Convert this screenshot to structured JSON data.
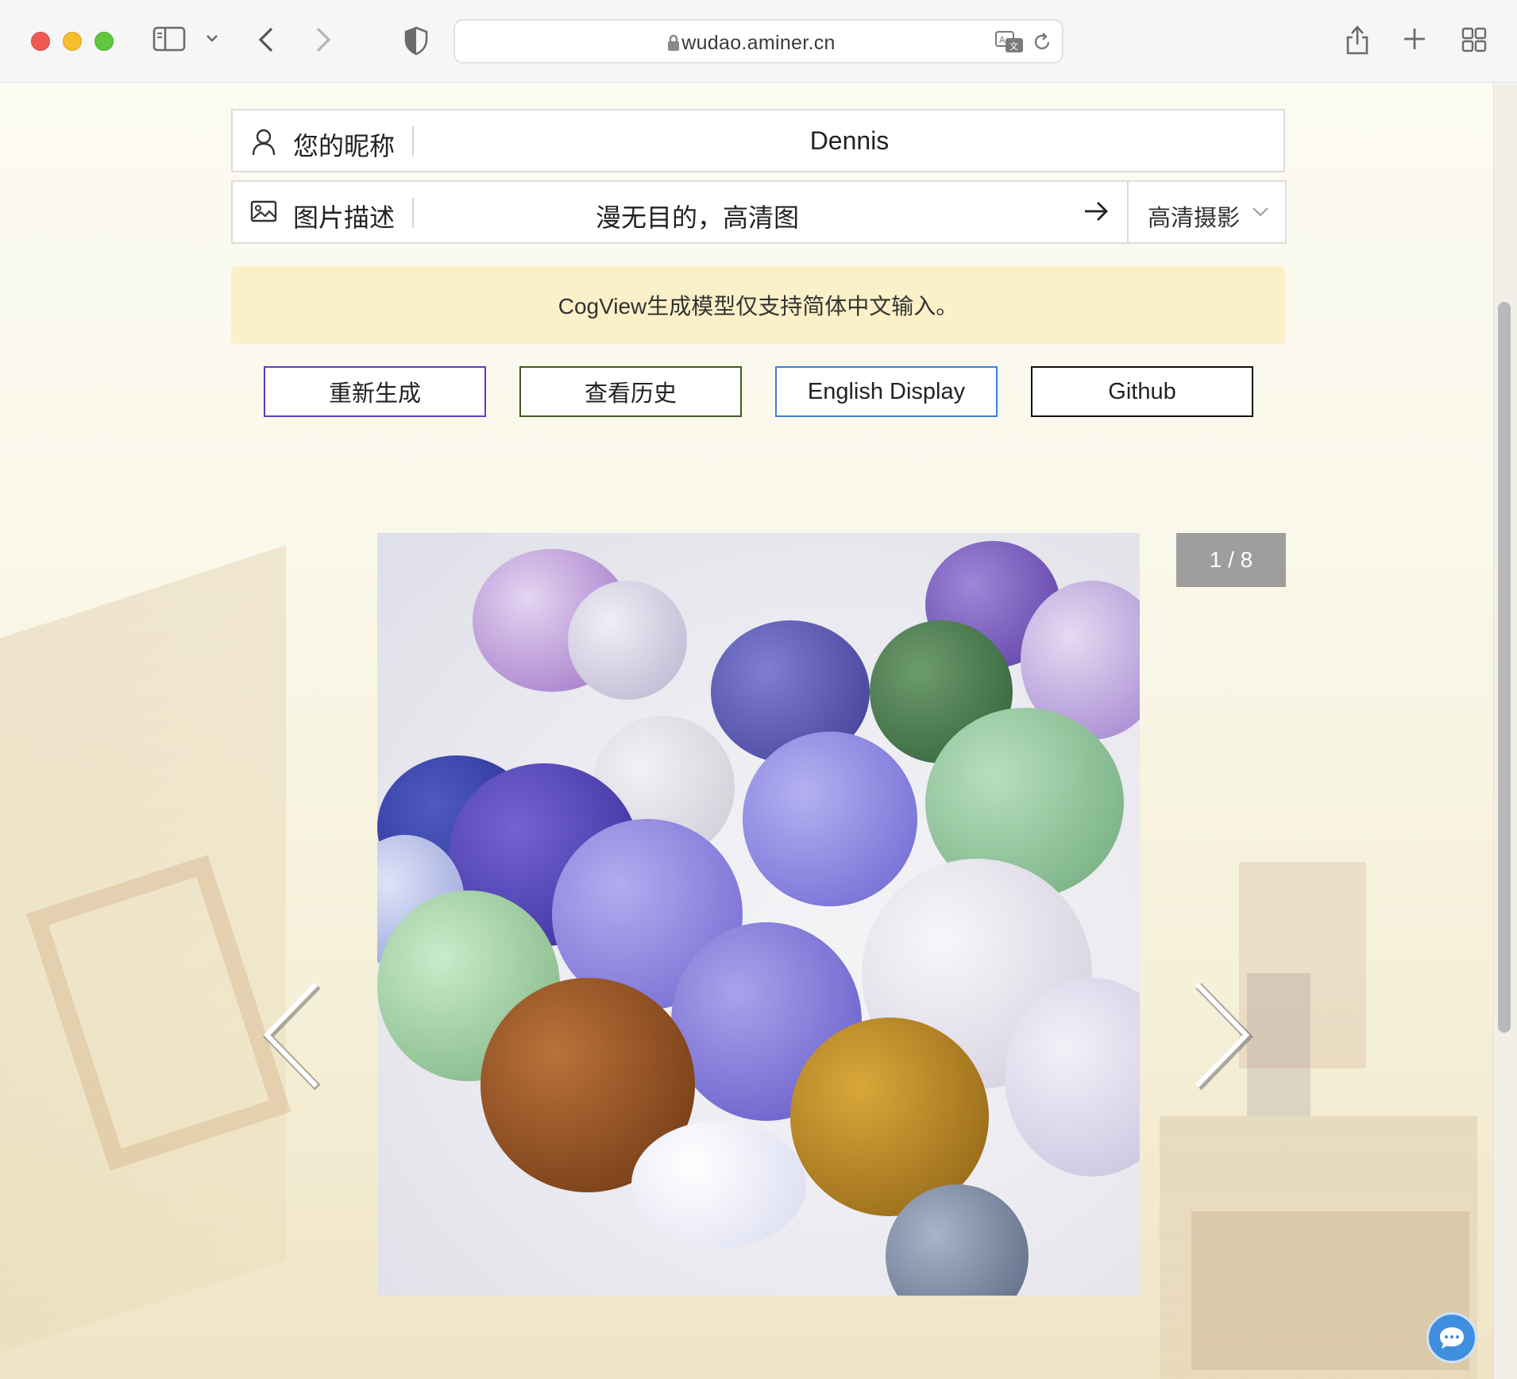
{
  "browser": {
    "url": "wudao.aminer.cn"
  },
  "form": {
    "nickname": {
      "label": "您的昵称",
      "value": "Dennis"
    },
    "prompt": {
      "label": "图片描述",
      "value": "漫无目的，高清图"
    },
    "style": {
      "selected": "高清摄影"
    }
  },
  "notice": "CogView生成模型仅支持简体中文输入。",
  "buttons": {
    "regenerate": "重新生成",
    "history": "查看历史",
    "english": "English Display",
    "github": "Github"
  },
  "carousel": {
    "counter": "1 / 8",
    "current": 1,
    "total": 8
  },
  "icons": {
    "nickname": "user-icon",
    "prompt": "image-icon",
    "submit": "arrow-right-icon",
    "chat": "chat-bubble-icon"
  },
  "colors": {
    "notice_bg": "#fbf0c8",
    "regen_border": "#5b3fbf",
    "history_border": "#3f5a1c",
    "english_border": "#3d7fd6",
    "github_border": "#111111",
    "counter_bg": "#9e9e9e",
    "chat_button": "#3f8fde"
  }
}
